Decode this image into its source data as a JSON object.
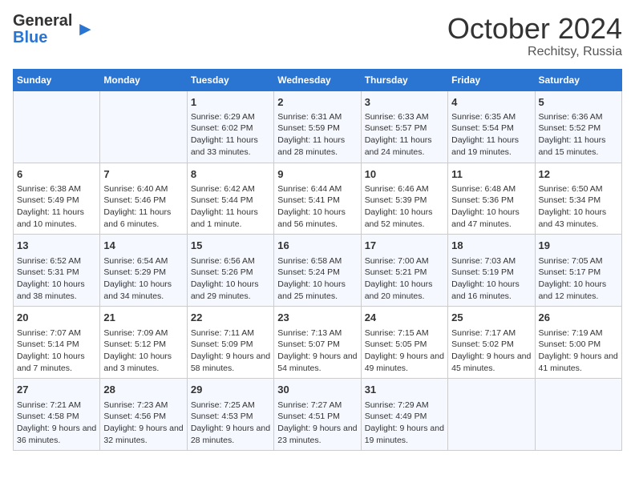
{
  "logo": {
    "general": "General",
    "blue": "Blue"
  },
  "title": {
    "month": "October 2024",
    "location": "Rechitsy, Russia"
  },
  "weekdays": [
    "Sunday",
    "Monday",
    "Tuesday",
    "Wednesday",
    "Thursday",
    "Friday",
    "Saturday"
  ],
  "rows": [
    [
      {
        "day": "",
        "info": ""
      },
      {
        "day": "",
        "info": ""
      },
      {
        "day": "1",
        "info": "Sunrise: 6:29 AM\nSunset: 6:02 PM\nDaylight: 11 hours and 33 minutes."
      },
      {
        "day": "2",
        "info": "Sunrise: 6:31 AM\nSunset: 5:59 PM\nDaylight: 11 hours and 28 minutes."
      },
      {
        "day": "3",
        "info": "Sunrise: 6:33 AM\nSunset: 5:57 PM\nDaylight: 11 hours and 24 minutes."
      },
      {
        "day": "4",
        "info": "Sunrise: 6:35 AM\nSunset: 5:54 PM\nDaylight: 11 hours and 19 minutes."
      },
      {
        "day": "5",
        "info": "Sunrise: 6:36 AM\nSunset: 5:52 PM\nDaylight: 11 hours and 15 minutes."
      }
    ],
    [
      {
        "day": "6",
        "info": "Sunrise: 6:38 AM\nSunset: 5:49 PM\nDaylight: 11 hours and 10 minutes."
      },
      {
        "day": "7",
        "info": "Sunrise: 6:40 AM\nSunset: 5:46 PM\nDaylight: 11 hours and 6 minutes."
      },
      {
        "day": "8",
        "info": "Sunrise: 6:42 AM\nSunset: 5:44 PM\nDaylight: 11 hours and 1 minute."
      },
      {
        "day": "9",
        "info": "Sunrise: 6:44 AM\nSunset: 5:41 PM\nDaylight: 10 hours and 56 minutes."
      },
      {
        "day": "10",
        "info": "Sunrise: 6:46 AM\nSunset: 5:39 PM\nDaylight: 10 hours and 52 minutes."
      },
      {
        "day": "11",
        "info": "Sunrise: 6:48 AM\nSunset: 5:36 PM\nDaylight: 10 hours and 47 minutes."
      },
      {
        "day": "12",
        "info": "Sunrise: 6:50 AM\nSunset: 5:34 PM\nDaylight: 10 hours and 43 minutes."
      }
    ],
    [
      {
        "day": "13",
        "info": "Sunrise: 6:52 AM\nSunset: 5:31 PM\nDaylight: 10 hours and 38 minutes."
      },
      {
        "day": "14",
        "info": "Sunrise: 6:54 AM\nSunset: 5:29 PM\nDaylight: 10 hours and 34 minutes."
      },
      {
        "day": "15",
        "info": "Sunrise: 6:56 AM\nSunset: 5:26 PM\nDaylight: 10 hours and 29 minutes."
      },
      {
        "day": "16",
        "info": "Sunrise: 6:58 AM\nSunset: 5:24 PM\nDaylight: 10 hours and 25 minutes."
      },
      {
        "day": "17",
        "info": "Sunrise: 7:00 AM\nSunset: 5:21 PM\nDaylight: 10 hours and 20 minutes."
      },
      {
        "day": "18",
        "info": "Sunrise: 7:03 AM\nSunset: 5:19 PM\nDaylight: 10 hours and 16 minutes."
      },
      {
        "day": "19",
        "info": "Sunrise: 7:05 AM\nSunset: 5:17 PM\nDaylight: 10 hours and 12 minutes."
      }
    ],
    [
      {
        "day": "20",
        "info": "Sunrise: 7:07 AM\nSunset: 5:14 PM\nDaylight: 10 hours and 7 minutes."
      },
      {
        "day": "21",
        "info": "Sunrise: 7:09 AM\nSunset: 5:12 PM\nDaylight: 10 hours and 3 minutes."
      },
      {
        "day": "22",
        "info": "Sunrise: 7:11 AM\nSunset: 5:09 PM\nDaylight: 9 hours and 58 minutes."
      },
      {
        "day": "23",
        "info": "Sunrise: 7:13 AM\nSunset: 5:07 PM\nDaylight: 9 hours and 54 minutes."
      },
      {
        "day": "24",
        "info": "Sunrise: 7:15 AM\nSunset: 5:05 PM\nDaylight: 9 hours and 49 minutes."
      },
      {
        "day": "25",
        "info": "Sunrise: 7:17 AM\nSunset: 5:02 PM\nDaylight: 9 hours and 45 minutes."
      },
      {
        "day": "26",
        "info": "Sunrise: 7:19 AM\nSunset: 5:00 PM\nDaylight: 9 hours and 41 minutes."
      }
    ],
    [
      {
        "day": "27",
        "info": "Sunrise: 7:21 AM\nSunset: 4:58 PM\nDaylight: 9 hours and 36 minutes."
      },
      {
        "day": "28",
        "info": "Sunrise: 7:23 AM\nSunset: 4:56 PM\nDaylight: 9 hours and 32 minutes."
      },
      {
        "day": "29",
        "info": "Sunrise: 7:25 AM\nSunset: 4:53 PM\nDaylight: 9 hours and 28 minutes."
      },
      {
        "day": "30",
        "info": "Sunrise: 7:27 AM\nSunset: 4:51 PM\nDaylight: 9 hours and 23 minutes."
      },
      {
        "day": "31",
        "info": "Sunrise: 7:29 AM\nSunset: 4:49 PM\nDaylight: 9 hours and 19 minutes."
      },
      {
        "day": "",
        "info": ""
      },
      {
        "day": "",
        "info": ""
      }
    ]
  ]
}
